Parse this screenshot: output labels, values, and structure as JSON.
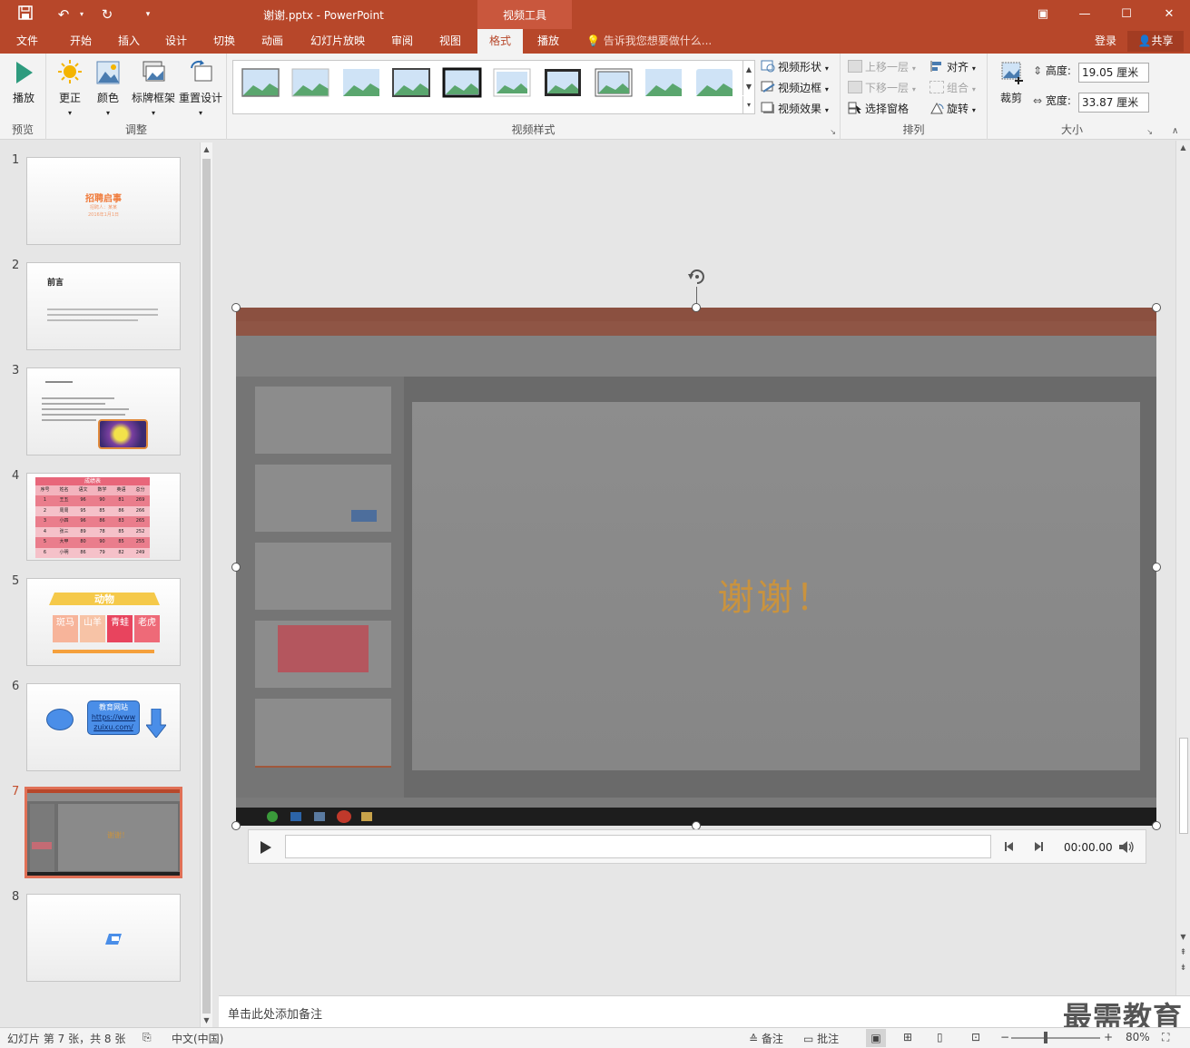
{
  "app": {
    "doc_title": "谢谢.pptx - PowerPoint",
    "context_tab": "视频工具",
    "window_controls": [
      "ribbon-display-icon",
      "minimize-icon",
      "maximize-icon",
      "close-icon"
    ]
  },
  "tabs": [
    {
      "label": "文件",
      "active": false
    },
    {
      "label": "开始",
      "active": false
    },
    {
      "label": "插入",
      "active": false
    },
    {
      "label": "设计",
      "active": false
    },
    {
      "label": "切换",
      "active": false
    },
    {
      "label": "动画",
      "active": false
    },
    {
      "label": "幻灯片放映",
      "active": false
    },
    {
      "label": "审阅",
      "active": false
    },
    {
      "label": "视图",
      "active": false
    },
    {
      "label": "格式",
      "active": true
    },
    {
      "label": "播放",
      "active": false
    }
  ],
  "tell_me": "告诉我您想要做什么...",
  "account": {
    "login": "登录",
    "share": "共享"
  },
  "ribbon": {
    "preview": {
      "play": "播放",
      "group": "预览"
    },
    "adjust": {
      "correct": "更正",
      "color": "颜色",
      "poster_frame": "标牌框架",
      "reset": "重置设计",
      "group": "调整"
    },
    "video_styles": {
      "shape": "视频形状",
      "border": "视频边框",
      "effects": "视频效果",
      "group": "视频样式"
    },
    "arrange": {
      "bring_forward": "上移一层",
      "send_backward": "下移一层",
      "selection_pane": "选择窗格",
      "align": "对齐",
      "group_cmd": "组合",
      "rotate": "旋转",
      "group": "排列"
    },
    "size": {
      "crop": "裁剪",
      "height_label": "高度:",
      "height_value": "19.05 厘米",
      "width_label": "宽度:",
      "width_value": "33.87 厘米",
      "group": "大小"
    }
  },
  "slides": [
    {
      "num": "1",
      "title": "招聘启事",
      "lines": [
        "招聘人：某某",
        "2016年1月1日"
      ]
    },
    {
      "num": "2",
      "title": "前言"
    },
    {
      "num": "3"
    },
    {
      "num": "4",
      "title": "成绩表",
      "headers": [
        "序号",
        "姓名",
        "语文",
        "数学",
        "英语",
        "总分"
      ],
      "rows": [
        [
          "1",
          "王五",
          "96",
          "90",
          "81",
          "269"
        ],
        [
          "2",
          "周周",
          "95",
          "85",
          "86",
          "266"
        ],
        [
          "3",
          "小四",
          "96",
          "86",
          "83",
          "265"
        ],
        [
          "4",
          "张三",
          "89",
          "78",
          "85",
          "252"
        ],
        [
          "5",
          "大甲",
          "80",
          "90",
          "85",
          "255"
        ],
        [
          "6",
          "小明",
          "86",
          "79",
          "82",
          "249"
        ]
      ]
    },
    {
      "num": "5",
      "title": "动物",
      "tiles": [
        "斑马",
        "山羊",
        "青蛙",
        "老虎"
      ]
    },
    {
      "num": "6",
      "box_title": "教育网站",
      "link1": "https://www",
      "link2": "zuixu.com/"
    },
    {
      "num": "7",
      "thank": "谢谢！",
      "selected": true
    },
    {
      "num": "8"
    }
  ],
  "video_frame": {
    "center_text": "谢谢！"
  },
  "player": {
    "time": "00:00.00"
  },
  "notes": {
    "placeholder": "单击此处添加备注",
    "watermark": "最需教育"
  },
  "status": {
    "slide_info": "幻灯片 第 7 张，共 8 张",
    "language": "中文(中国)",
    "notes_btn": "备注",
    "comments_btn": "批注",
    "zoom": "80%"
  },
  "colors": {
    "accent": "#b7472a",
    "selected_slide_border": "#e07056",
    "thank_text": "#e8a64a"
  }
}
